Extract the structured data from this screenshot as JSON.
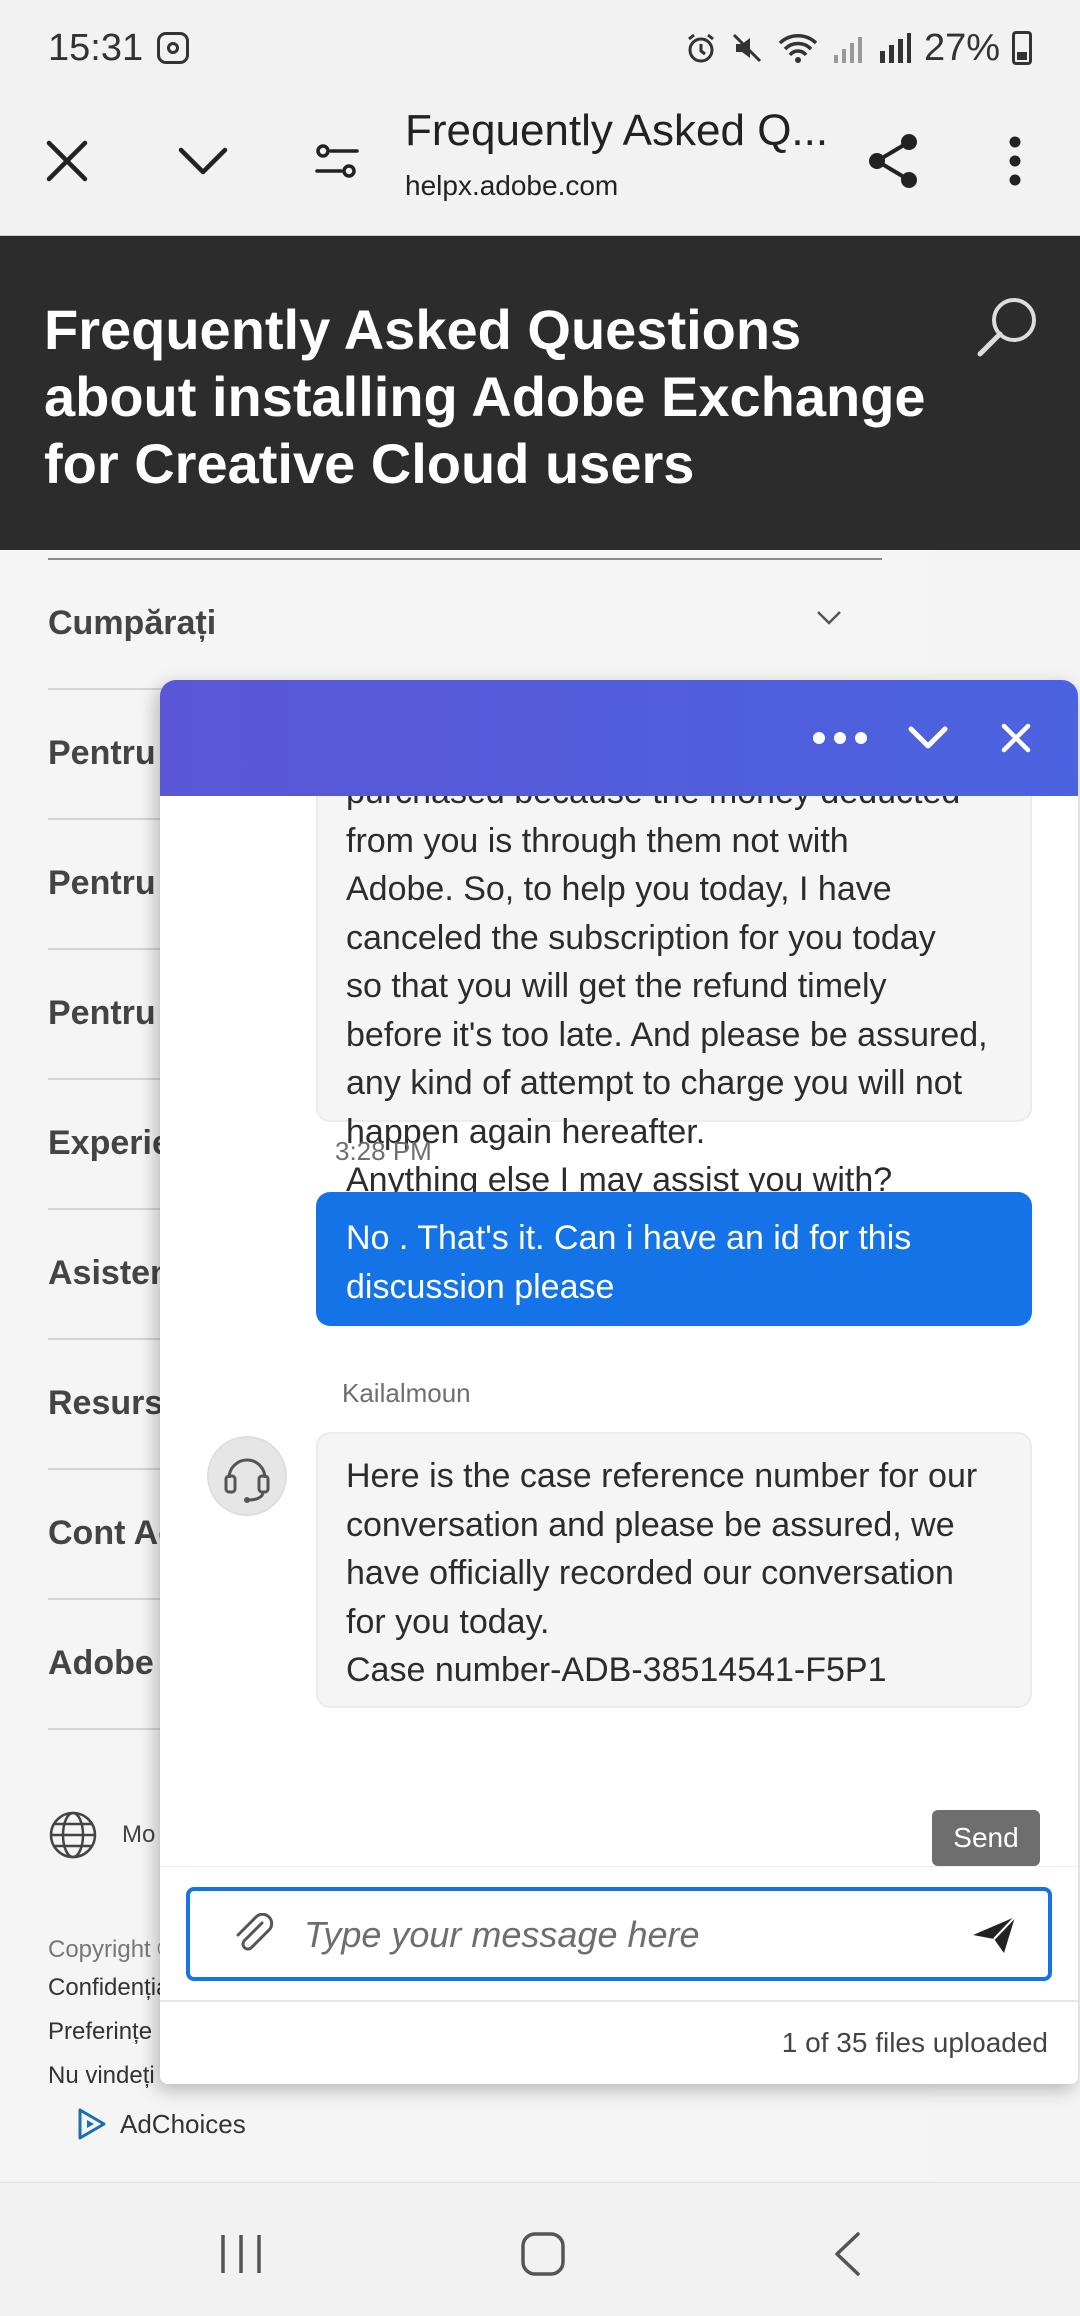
{
  "status_bar": {
    "time": "15:31",
    "battery": "27%"
  },
  "browser": {
    "title": "Frequently Asked Q...",
    "url": "helpx.adobe.com"
  },
  "page": {
    "title": "Frequently Asked Questions about installing Adobe Exchange for Creative Cloud users"
  },
  "nav": {
    "items": [
      {
        "label": "Cumpărați"
      },
      {
        "label": "Pentru"
      },
      {
        "label": "Pentru"
      },
      {
        "label": "Pentru"
      },
      {
        "label": "Experie"
      },
      {
        "label": "Asisten"
      },
      {
        "label": "Resurse"
      },
      {
        "label": "Cont Ac"
      },
      {
        "label": "Adobe"
      }
    ],
    "language": "Mo",
    "copyright": "Copyright ©",
    "links": [
      "Confidențialitate",
      "Preferințe",
      "Nu vindeți"
    ],
    "adchoices": "AdChoices"
  },
  "chat": {
    "messages": [
      {
        "from": "agent",
        "lines": [
          "purchased because the money deducted",
          "from you is through them not with",
          "Adobe. So, to help you today, I have",
          "canceled the subscription for you today",
          "so that you will get the refund timely",
          "before it's too late. And please be assured,",
          "any kind of attempt to charge you will not",
          "happen again hereafter.",
          "Anything else I may assist you with?"
        ],
        "time": "3:28 PM"
      },
      {
        "from": "user",
        "text": "No . That's it. Can i have an id for this discussion please"
      },
      {
        "from": "agent",
        "sender": "Kailalmoun",
        "lines": [
          "Here is the case reference number for our",
          "conversation and please be assured, we",
          "have officially recorded our conversation",
          "for you today.",
          "Case number-ADB-38514541-F5P1"
        ]
      }
    ],
    "send_tooltip": "Send",
    "input_placeholder": "Type your message here",
    "upload_status": "1 of 35 files uploaded"
  }
}
